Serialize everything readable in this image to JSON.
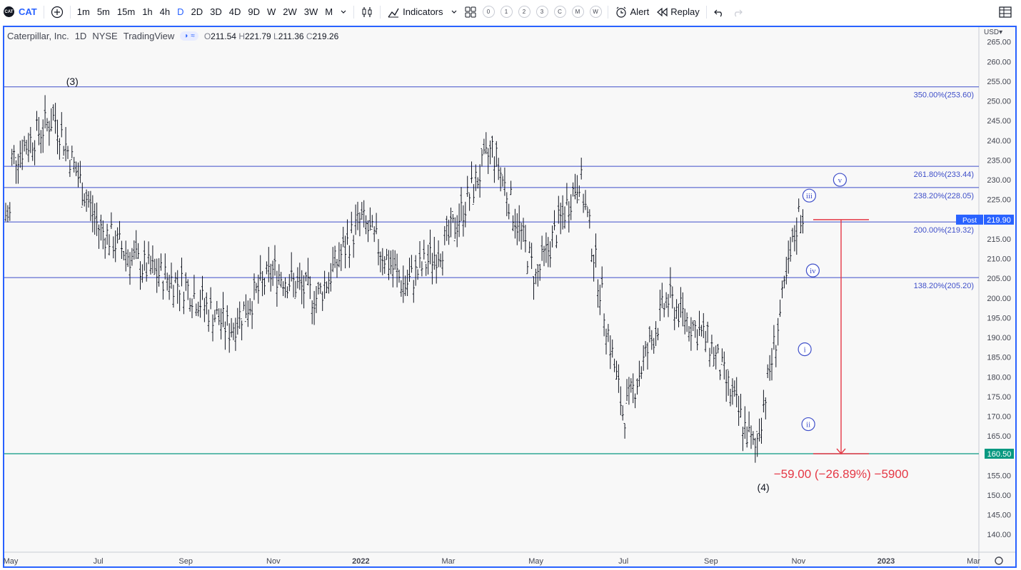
{
  "toolbar": {
    "symbol": "CAT",
    "logo_text": "CAT",
    "add_icon": "plus-circle-icon",
    "intervals": [
      "1m",
      "5m",
      "15m",
      "1h",
      "4h",
      "D",
      "2D",
      "3D",
      "4D",
      "9D",
      "W",
      "2W",
      "3W",
      "M"
    ],
    "active_interval": "D",
    "indicators_label": "Indicators",
    "template_chips": [
      "0",
      "1",
      "2",
      "3",
      "C",
      "M",
      "W"
    ],
    "alert_label": "Alert",
    "replay_label": "Replay"
  },
  "legend": {
    "name": "Caterpillar, Inc.",
    "interval": "1D",
    "exchange": "NYSE",
    "source": "TradingView",
    "open_label": "O",
    "open": "211.54",
    "high_label": "H",
    "high": "221.79",
    "low_label": "L",
    "low": "211.36",
    "close_label": "C",
    "close": "219.26"
  },
  "currency": "USD",
  "colors": {
    "up": "#26a69a",
    "down": "#ef5350",
    "bars": "#131722",
    "fib": "#3f4fc9",
    "measure": "#e53946",
    "accent": "#2962ff",
    "support": "#089981"
  },
  "chart_data": {
    "type": "line",
    "title": "",
    "ylim": [
      136,
      267
    ],
    "y_ticks": [
      "140.00",
      "145.00",
      "150.00",
      "155.00",
      "160.00",
      "165.00",
      "170.00",
      "175.00",
      "180.00",
      "185.00",
      "190.00",
      "195.00",
      "200.00",
      "205.00",
      "210.00",
      "215.00",
      "220.00",
      "225.00",
      "230.00",
      "235.00",
      "240.00",
      "245.00",
      "250.00",
      "255.00",
      "260.00",
      "265.00"
    ],
    "x_ticks": [
      "May",
      "Jul",
      "Sep",
      "Nov",
      "2022",
      "Mar",
      "May",
      "Jul",
      "Sep",
      "Nov",
      "2023",
      "Mar"
    ],
    "x_ticks_bold": [
      "2022",
      "2023"
    ],
    "series": [
      {
        "x": [
          "2021-05",
          "2021-06",
          "2021-07",
          "2021-08",
          "2021-09",
          "2021-10",
          "2021-11",
          "2021-12",
          "2022-01",
          "2022-02",
          "2022-03",
          "2022-04",
          "2022-05",
          "2022-06",
          "2022-07",
          "2022-08",
          "2022-09",
          "2022-10",
          "2022-11"
        ],
        "values": [
          235,
          246,
          218,
          208,
          203,
          192,
          207,
          200,
          220,
          203,
          215,
          238,
          205,
          231,
          170,
          200,
          188,
          161,
          221
        ]
      }
    ],
    "fib_levels": [
      {
        "label": "350.00%(253.60)",
        "value": 253.6
      },
      {
        "label": "261.80%(233.44)",
        "value": 233.44
      },
      {
        "label": "238.20%(228.05)",
        "value": 228.05
      },
      {
        "label": "200.00%(219.32)",
        "value": 219.32
      },
      {
        "label": "138.20%(205.20)",
        "value": 205.2
      }
    ],
    "current_price": {
      "label": "Post",
      "value": "219.90"
    },
    "support": {
      "value": "160.50"
    },
    "measure": {
      "from": 219.9,
      "to": 160.5,
      "text": "−59.00 (−26.89%) −5900"
    },
    "wave_labels": [
      {
        "text": "(3)",
        "x": "2021-06",
        "y": 255
      },
      {
        "text": "(4)",
        "x": "2022-10",
        "y": 152
      },
      {
        "text": "i",
        "x": "2022-10",
        "y": 187,
        "circled": true
      },
      {
        "text": "ii",
        "x": "2022-10",
        "y": 168,
        "circled": true
      },
      {
        "text": "iii",
        "x": "2022-11",
        "y": 226,
        "circled": true
      },
      {
        "text": "iv",
        "x": "2022-11",
        "y": 207,
        "circled": true
      },
      {
        "text": "v",
        "x": "2022-11",
        "y": 230,
        "circled": true
      }
    ]
  }
}
